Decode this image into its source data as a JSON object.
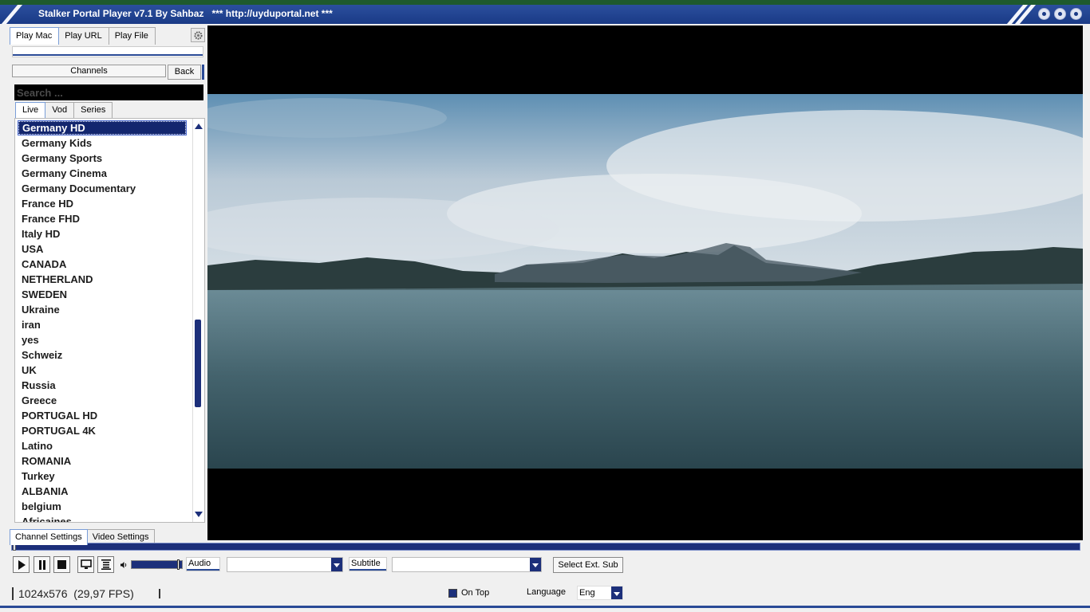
{
  "titlebar": {
    "title": "Stalker Portal Player v7.1 By Sahbaz",
    "url_text": "*** http://uyduportal.net ***"
  },
  "left_panel": {
    "top_tabs": [
      "Play Mac",
      "Play URL",
      "Play File"
    ],
    "channels_label": "Channels",
    "back_label": "Back",
    "search_placeholder": "Search ...",
    "content_tabs": [
      "Live",
      "Vod",
      "Series"
    ],
    "channels": [
      "Germany HD",
      "Germany Kids",
      "Germany Sports",
      "Germany Cinema",
      "Germany Documentary",
      "France HD",
      "France FHD",
      "Italy HD",
      "USA",
      "CANADA",
      "NETHERLAND",
      "SWEDEN",
      "Ukraine",
      "iran",
      "yes",
      "Schweiz",
      "UK",
      "Russia",
      "Greece",
      "PORTUGAL HD",
      "PORTUGAL 4K",
      "Latino",
      "ROMANIA",
      "Turkey",
      "ALBANIA",
      "belgium",
      "Africaines"
    ],
    "selected_channel": "Germany HD",
    "bottom_tabs": [
      "Channel Settings",
      "Video Settings"
    ]
  },
  "controls": {
    "audio_label": "Audio",
    "subtitle_label": "Subtitle",
    "select_ext_sub": "Select Ext. Sub",
    "audio_value": "",
    "subtitle_value": ""
  },
  "status": {
    "resolution": "1024x576",
    "fps": "(29,97 FPS)",
    "on_top_label": "On Top",
    "on_top_checked": true,
    "language_label": "Language",
    "language_value": "Eng"
  },
  "colors": {
    "accent": "#1c2f7a",
    "titlebar": "#1a3a86",
    "selection": "#13266e"
  }
}
